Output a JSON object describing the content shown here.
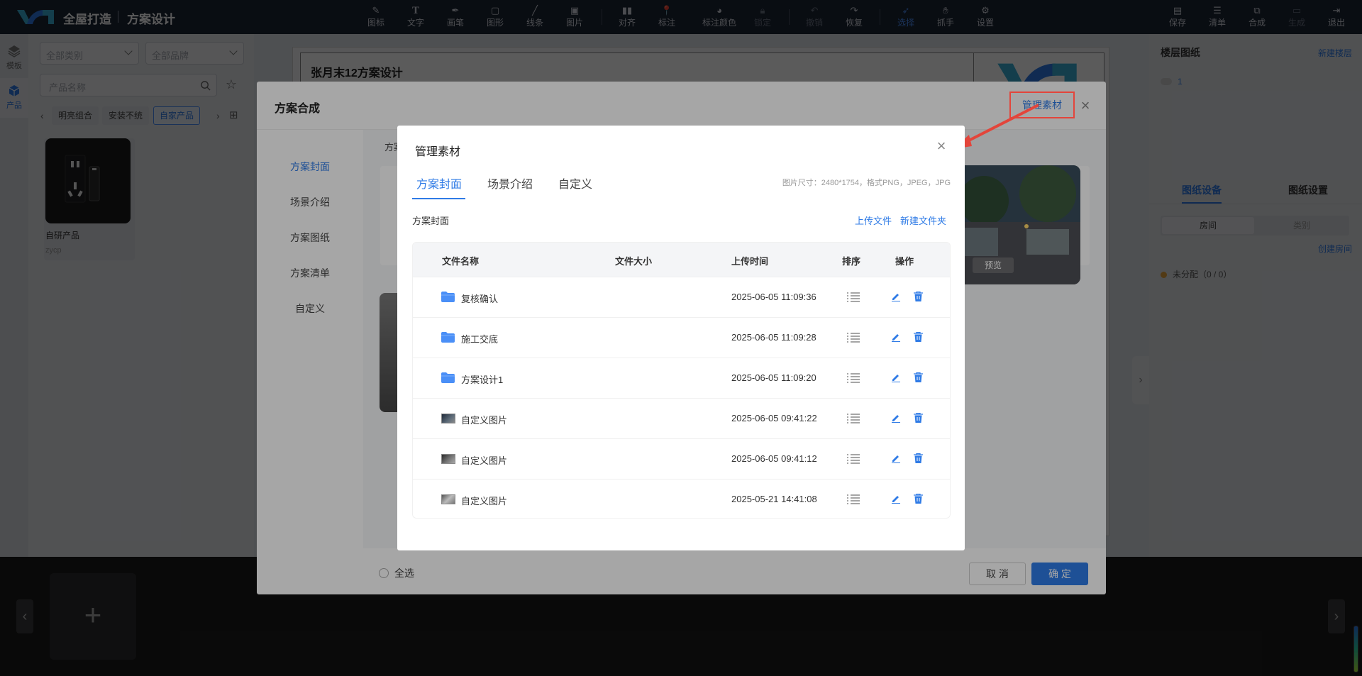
{
  "app": {
    "brand": "全屋打造",
    "section": "方案设计"
  },
  "toolbar": {
    "tools": [
      {
        "label": "图标",
        "icon": "icon-brush-icon"
      },
      {
        "label": "文字",
        "icon": "text-icon"
      },
      {
        "label": "画笔",
        "icon": "pen-icon"
      },
      {
        "label": "图形",
        "icon": "shape-icon"
      },
      {
        "label": "线条",
        "icon": "line-icon"
      },
      {
        "label": "图片",
        "icon": "image-icon"
      },
      {
        "label": "对齐",
        "icon": "align-icon"
      },
      {
        "label": "标注",
        "icon": "pin-icon"
      },
      {
        "label": "标注颜色",
        "icon": "palette-icon"
      },
      {
        "label": "锁定",
        "icon": "lock-icon",
        "disabled": true
      },
      {
        "label": "撤销",
        "icon": "undo-icon",
        "disabled": true
      },
      {
        "label": "恢复",
        "icon": "redo-icon"
      },
      {
        "label": "选择",
        "icon": "cursor-icon",
        "active": true
      },
      {
        "label": "抓手",
        "icon": "hand-icon"
      },
      {
        "label": "设置",
        "icon": "gear-icon"
      }
    ],
    "actions": [
      {
        "label": "保存",
        "icon": "save-icon"
      },
      {
        "label": "清单",
        "icon": "list-icon"
      },
      {
        "label": "合成",
        "icon": "compose-icon"
      },
      {
        "label": "生成",
        "icon": "generate-icon",
        "disabled": true
      },
      {
        "label": "退出",
        "icon": "exit-icon"
      }
    ]
  },
  "rail": {
    "items": [
      {
        "label": "模板",
        "icon": "layers-icon"
      },
      {
        "label": "产品",
        "icon": "cube-icon",
        "active": true
      }
    ]
  },
  "product_panel": {
    "category_placeholder": "全部类别",
    "brand_placeholder": "全部品牌",
    "search_placeholder": "产品名称",
    "chips": [
      "明亮组合",
      "安装不统",
      "自家产品"
    ],
    "active_chip": "自家产品",
    "card": {
      "name": "自研产品",
      "sub": "zycp"
    }
  },
  "document": {
    "title": "张月末12方案设计"
  },
  "right_panel": {
    "title": "楼层图纸",
    "new_floor": "新建楼层",
    "floor_item": "1",
    "tabs": [
      "图纸设备",
      "图纸设置"
    ],
    "segments": [
      "房间",
      "类别"
    ],
    "create_room": "创建房间",
    "unassigned": "未分配（0 / 0）"
  },
  "dialog_compose": {
    "title": "方案合成",
    "manage_button": "管理素材",
    "nav": [
      "方案封面",
      "场景介绍",
      "方案图纸",
      "方案清单",
      "自定义"
    ],
    "section_label": "方案",
    "preview_label": "预览",
    "select_all": "全选",
    "cancel": "取 消",
    "confirm": "确 定"
  },
  "dialog_manage": {
    "title": "管理素材",
    "tabs": [
      "方案封面",
      "场景介绍",
      "自定义"
    ],
    "hint": "图片尺寸：2480*1754，格式PNG，JPEG，JPG",
    "subtitle": "方案封面",
    "upload": "上传文件",
    "new_folder": "新建文件夹",
    "columns": [
      "文件名称",
      "文件大小",
      "上传时间",
      "排序",
      "操作"
    ],
    "rows": [
      {
        "type": "folder",
        "name": "复核确认",
        "size": "",
        "time": "2025-06-05 11:09:36"
      },
      {
        "type": "folder",
        "name": "施工交底",
        "size": "",
        "time": "2025-06-05 11:09:28"
      },
      {
        "type": "folder",
        "name": "方案设计1",
        "size": "",
        "time": "2025-06-05 11:09:20"
      },
      {
        "type": "image",
        "name": "自定义图片",
        "size": "",
        "time": "2025-06-05 09:41:22"
      },
      {
        "type": "image",
        "name": "自定义图片",
        "size": "",
        "time": "2025-06-05 09:41:12"
      },
      {
        "type": "image",
        "name": "自定义图片",
        "size": "",
        "time": "2025-05-21 14:41:08"
      }
    ]
  },
  "colors": {
    "accent": "#2f7be6",
    "highlight": "#e3453b",
    "topbar": "#1d2536"
  }
}
